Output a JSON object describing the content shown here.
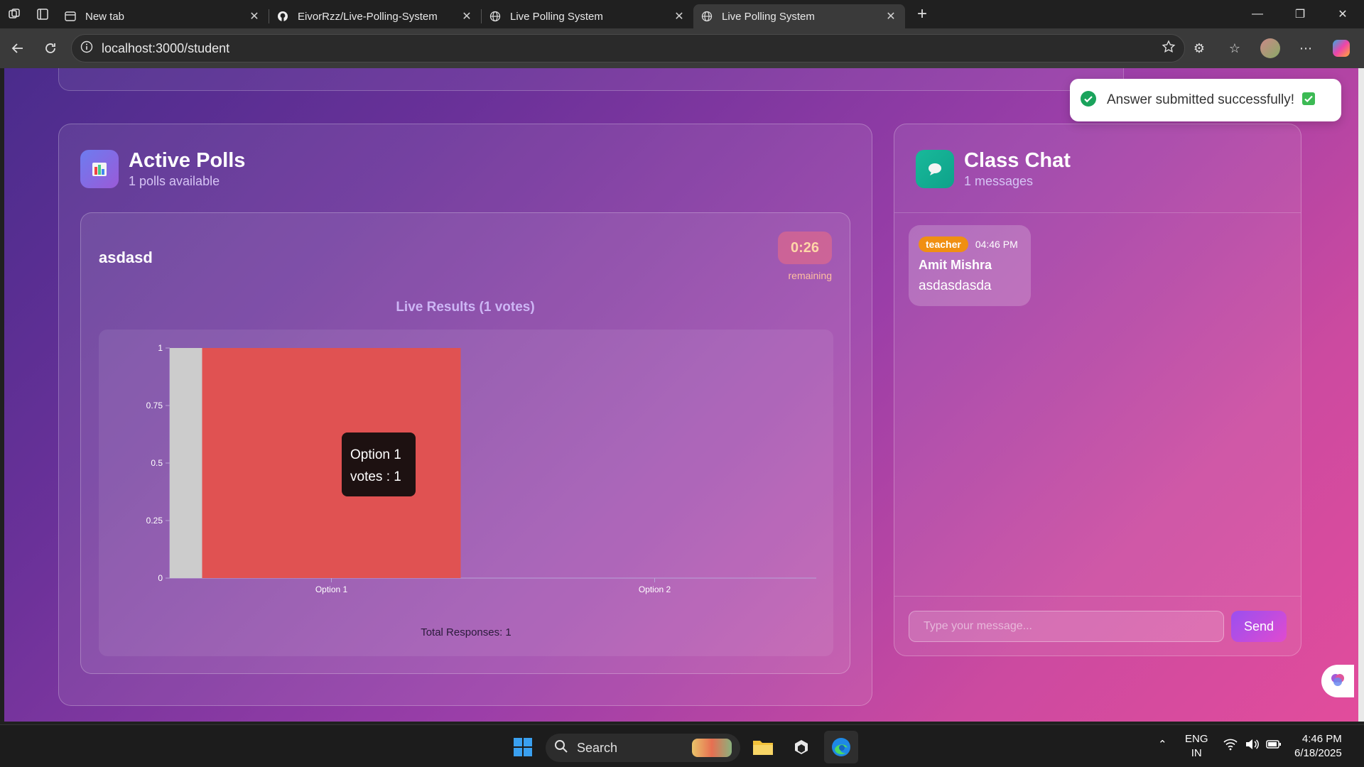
{
  "browser": {
    "tabs": [
      {
        "title": "New tab",
        "icon": "newtab-icon",
        "active": false
      },
      {
        "title": "EivorRzz/Live-Polling-System",
        "icon": "github-icon",
        "active": false
      },
      {
        "title": "Live Polling System",
        "icon": "globe-icon",
        "active": false
      },
      {
        "title": "Live Polling System",
        "icon": "globe-icon",
        "active": true
      }
    ],
    "url_host": "localhost",
    "url_path": ":3000/student"
  },
  "polls": {
    "title": "Active Polls",
    "subtitle": "1 polls available",
    "question": "asdasd",
    "timer": "0:26",
    "timer_label": "remaining",
    "results_title": "Live Results (1 votes)",
    "total": "Total Responses: 1",
    "tooltip": {
      "line1": "Option 1",
      "line2": "votes : 1"
    }
  },
  "chart_data": {
    "type": "bar",
    "categories": [
      "Option 1",
      "Option 2"
    ],
    "values": [
      1,
      0
    ],
    "ylim": [
      0,
      1
    ],
    "yticks": [
      "0",
      "0.25",
      "0.5",
      "0.75",
      "1"
    ],
    "colors": {
      "bar": "#e05252",
      "highlight": "#cccccc"
    }
  },
  "chat": {
    "title": "Class Chat",
    "subtitle": "1 messages",
    "messages": [
      {
        "role": "teacher",
        "time": "04:46 PM",
        "author": "Amit Mishra",
        "text": "asdasdasda"
      }
    ],
    "placeholder": "Type your message...",
    "send_label": "Send"
  },
  "toast": {
    "text": "Answer submitted successfully!",
    "color": "#1aa35c"
  },
  "taskbar": {
    "search_label": "Search",
    "lang_top": "ENG",
    "lang_bottom": "IN",
    "time": "4:46 PM",
    "date": "6/18/2025"
  }
}
